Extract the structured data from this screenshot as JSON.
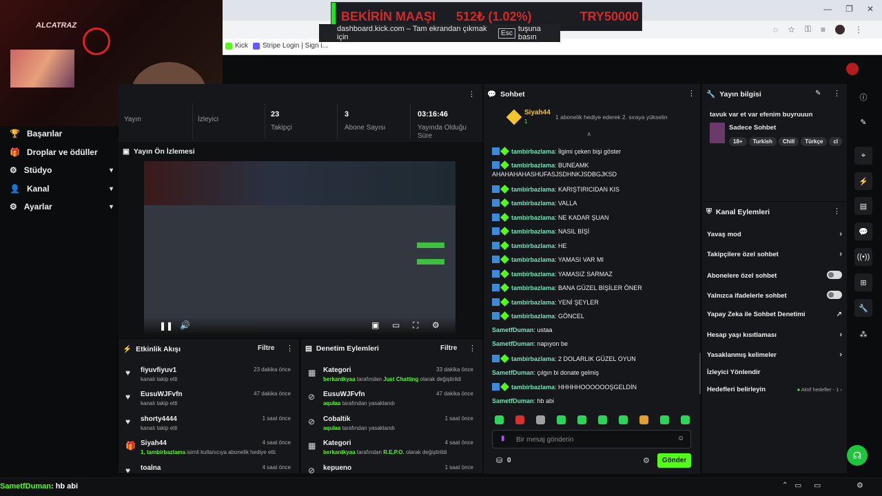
{
  "ticker": {
    "label": "BEKİRİN MAAŞI",
    "value": "512₺ (1.02%)",
    "total": "TRY50000"
  },
  "fullscreen_notice": {
    "prefix": "dashboard.kick.com – Tam ekrandan çıkmak için",
    "key": "Esc",
    "suffix": "tuşuna basın"
  },
  "bookmarks": [
    "Kick",
    "Stripe Login | Sign i..."
  ],
  "webcam": {
    "logo": "ALCATRAZ"
  },
  "nav": [
    {
      "label": "Başarılar",
      "icon": "trophy-icon",
      "chev": ""
    },
    {
      "label": "Droplar ve ödüller",
      "icon": "gift-icon",
      "chev": ""
    },
    {
      "label": "Stüdyo",
      "icon": "studio-icon",
      "chev": "▾"
    },
    {
      "label": "Kanal",
      "icon": "channel-icon",
      "chev": "▾"
    },
    {
      "label": "Ayarlar",
      "icon": "gear-icon",
      "chev": "▾"
    }
  ],
  "stats": [
    {
      "value": "",
      "label": "Yayın"
    },
    {
      "value": "",
      "label": "İzleyici"
    },
    {
      "value": "23",
      "label": "Takipçi"
    },
    {
      "value": "3",
      "label": "Abone Sayısı"
    },
    {
      "value": "03:16:46",
      "label": "Yayında Olduğu Süre"
    }
  ],
  "preview": {
    "title": "Yayın Ön İzlemesi"
  },
  "activity": {
    "title": "Etkinlik Akışı",
    "filter": "Filtre",
    "items": [
      {
        "name": "fiyuvfiyuv1",
        "sub": "kanalı takip etti",
        "time": "23 dakika önce",
        "icon": "heart-icon"
      },
      {
        "name": "EusuWJFvfn",
        "sub": "kanalı takip etti",
        "time": "47 dakika önce",
        "icon": "heart-icon"
      },
      {
        "name": "shorty4444",
        "sub": "kanalı takip etti",
        "time": "1 saat önce",
        "icon": "heart-icon"
      },
      {
        "name": "Siyah44",
        "sub_green": "1, tambirbazlama",
        "sub": " isimli kullanıcıya abonelik hediye etti.",
        "time": "4 saat önce",
        "icon": "gift-icon"
      },
      {
        "name": "toalna",
        "sub": "",
        "time": "4 saat önce",
        "icon": "heart-icon"
      }
    ]
  },
  "modlog": {
    "title": "Denetim Eylemleri",
    "filter": "Filtre",
    "items": [
      {
        "name": "Kategori",
        "actor": "berkantkyaa",
        "mid": " tarafından ",
        "obj": "Just Chatting",
        "tail": " olarak değiştirildi",
        "time": "33 dakika önce",
        "icon": "category-icon"
      },
      {
        "name": "EusuWJFvfn",
        "actor": "aqulaa",
        "mid": " tarafından yasaklandı",
        "obj": "",
        "tail": "",
        "time": "47 dakika önce",
        "icon": "ban-icon"
      },
      {
        "name": "Cobaltik",
        "actor": "aqulaa",
        "mid": " tarafından yasaklandı",
        "obj": "",
        "tail": "",
        "time": "1 saat önce",
        "icon": "ban-icon"
      },
      {
        "name": "Kategori",
        "actor": "berkantkyaa",
        "mid": " tarafından ",
        "obj": "R.E.P.O.",
        "tail": " olarak değiştirildi",
        "time": "4 saat önce",
        "icon": "category-icon"
      },
      {
        "name": "kepueno",
        "actor": "",
        "mid": "",
        "obj": "",
        "tail": "",
        "time": "1 saat önce",
        "icon": "ban-icon"
      }
    ]
  },
  "chat": {
    "title": "Sohbet",
    "pinned": {
      "user": "Siyah44",
      "count": "1",
      "text": "1 abonelik hediye ederek 2. sıraya yükselin"
    },
    "messages": [
      {
        "user": "tambirbazlama",
        "text": ": İlgimi çeken bişi göster",
        "badges": true
      },
      {
        "user": "tambirbazlama",
        "text": ": BUNEAMK",
        "badges": true
      },
      {
        "user": "",
        "text": "AHAHAHAHASHUFASJSDHNKJSDBGJKSD",
        "badges": false
      },
      {
        "user": "tambirbazlama",
        "text": ": KARIŞTIRICIDAN KIS",
        "badges": true
      },
      {
        "user": "tambirbazlama",
        "text": ": VALLA",
        "badges": true
      },
      {
        "user": "tambirbazlama",
        "text": ": NE KADAR ŞUAN",
        "badges": true
      },
      {
        "user": "tambirbazlama",
        "text": ": NASIL BİŞİ",
        "badges": true
      },
      {
        "user": "tambirbazlama",
        "text": ": HE",
        "badges": true
      },
      {
        "user": "tambirbazlama",
        "text": ": YAMASI VAR MI",
        "badges": true
      },
      {
        "user": "tambirbazlama",
        "text": ": YAMASIZ SARMAZ",
        "badges": true
      },
      {
        "user": "tambirbazlama",
        "text": ": BANA GÜZEL BİŞİLER ÖNER",
        "badges": true
      },
      {
        "user": "tambirbazlama",
        "text": ": YENİ ŞEYLER",
        "badges": true
      },
      {
        "user": "tambirbazlama",
        "text": ": GÖNCEL",
        "badges": true
      },
      {
        "user": "SametfDuman",
        "text": ": ustaa",
        "badges": false
      },
      {
        "user": "SametfDuman",
        "text": ": napıyon be",
        "badges": false
      },
      {
        "user": "tambirbazlama",
        "text": ": 2 DOLARLIK GÜZEL OYUN",
        "badges": true
      },
      {
        "user": "SametfDuman",
        "text": ": çılgın bi donate gelmiş",
        "badges": false
      },
      {
        "user": "tambirbazlama",
        "text": ": HHHHHOOOOOOŞGELDİN",
        "badges": true
      },
      {
        "user": "SametfDuman",
        "text": ": hb abi",
        "badges": false
      }
    ],
    "placeholder": "Bir mesaj gönderin",
    "points": "0",
    "send": "Gönder"
  },
  "info": {
    "title": "Yayın bilgisi",
    "stream_title": "tavuk var et var efenim buyruuun",
    "category": "Sadece Sohbet",
    "tags": [
      "18+",
      "Turkish",
      "Chill",
      "Türkçe",
      "cl"
    ]
  },
  "channel_actions": {
    "title": "Kanal Eylemleri",
    "items": [
      {
        "label": "Yavaş mod",
        "control": "chevron"
      },
      {
        "label": "Takipçilere özel sohbet",
        "control": "chevron"
      },
      {
        "label": "Abonelere özel sohbet",
        "control": "toggle"
      },
      {
        "label": "Yalnızca ifadelerle sohbet",
        "control": "toggle"
      },
      {
        "label": "Yapay Zeka ile Sohbet Denetimi",
        "control": "external"
      },
      {
        "label": "Hesap yaşı kısıtlaması",
        "control": "chevron"
      },
      {
        "label": "Yasaklanmış kelimeler",
        "control": "chevron"
      },
      {
        "label": "İzleyici Yönlendir",
        "control": "none"
      },
      {
        "label": "Hedefleri belirleyin",
        "control": "goal"
      }
    ],
    "goal_status": "Aktif hedefler - 1"
  },
  "bottom_overlay": {
    "user": "SametfDuman",
    "text": ": hb abi"
  },
  "colors": {
    "accent": "#53fc18",
    "panel": "#16171a",
    "ticker_red": "#d02a2a"
  }
}
